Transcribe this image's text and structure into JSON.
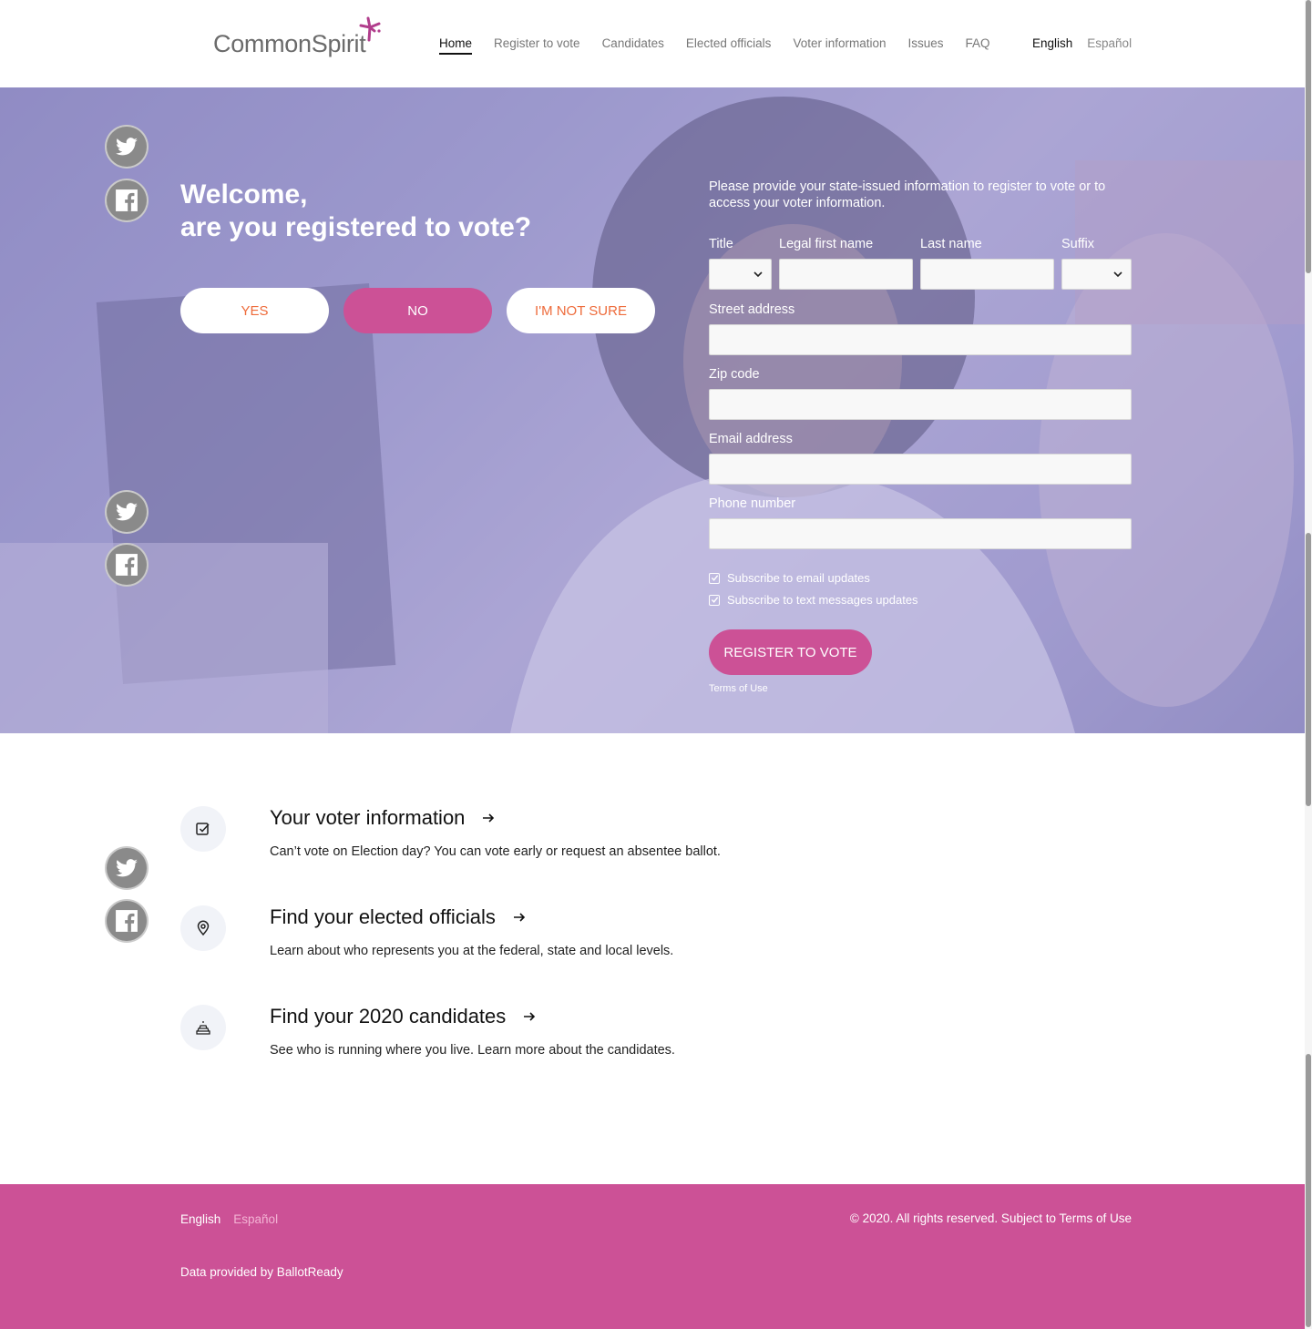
{
  "header": {
    "logo": "CommonSpirit",
    "nav": [
      "Home",
      "Register to vote",
      "Candidates",
      "Elected officials",
      "Voter information",
      "Issues",
      "FAQ"
    ],
    "active_nav": "Home",
    "languages": [
      "English",
      "Español"
    ],
    "active_language": "English"
  },
  "hero": {
    "welcome_line1": "Welcome,",
    "welcome_line2": "are you registered to vote?",
    "answers": [
      "YES",
      "NO",
      "I'M NOT SURE"
    ],
    "form": {
      "intro": "Please provide your state-issued information to register to vote or to access your voter information.",
      "title_label": "Title",
      "first_name_label": "Legal first name",
      "last_name_label": "Last name",
      "suffix_label": "Suffix",
      "street_label": "Street address",
      "zip_label": "Zip code",
      "email_label": "Email address",
      "phone_label": "Phone number",
      "email_updates": "Subscribe to email updates",
      "text_updates": "Subscribe to text messages updates",
      "submit": "REGISTER TO VOTE",
      "terms": "Terms of Use"
    }
  },
  "info": [
    {
      "title": "Your voter information",
      "desc": "Can’t vote on Election day? You can vote early or request an absentee ballot.",
      "icon": "checkbox-icon"
    },
    {
      "title": "Find your elected officials",
      "desc": "Learn about who represents you at the federal, state and local levels.",
      "icon": "location-pin-icon"
    },
    {
      "title": "Find your 2020 candidates",
      "desc": "See who is running where you live. Learn more about the candidates.",
      "icon": "podium-icon"
    }
  ],
  "footer": {
    "languages": [
      "English",
      "Español"
    ],
    "copyright": "© 2020. All rights reserved. Subject to Terms of Use",
    "data_source": "Data provided by BallotReady"
  },
  "colors": {
    "brand_pink": "#cc5196",
    "accent_orange": "#ee6b3b",
    "hero_tint": "#a09fcc"
  }
}
